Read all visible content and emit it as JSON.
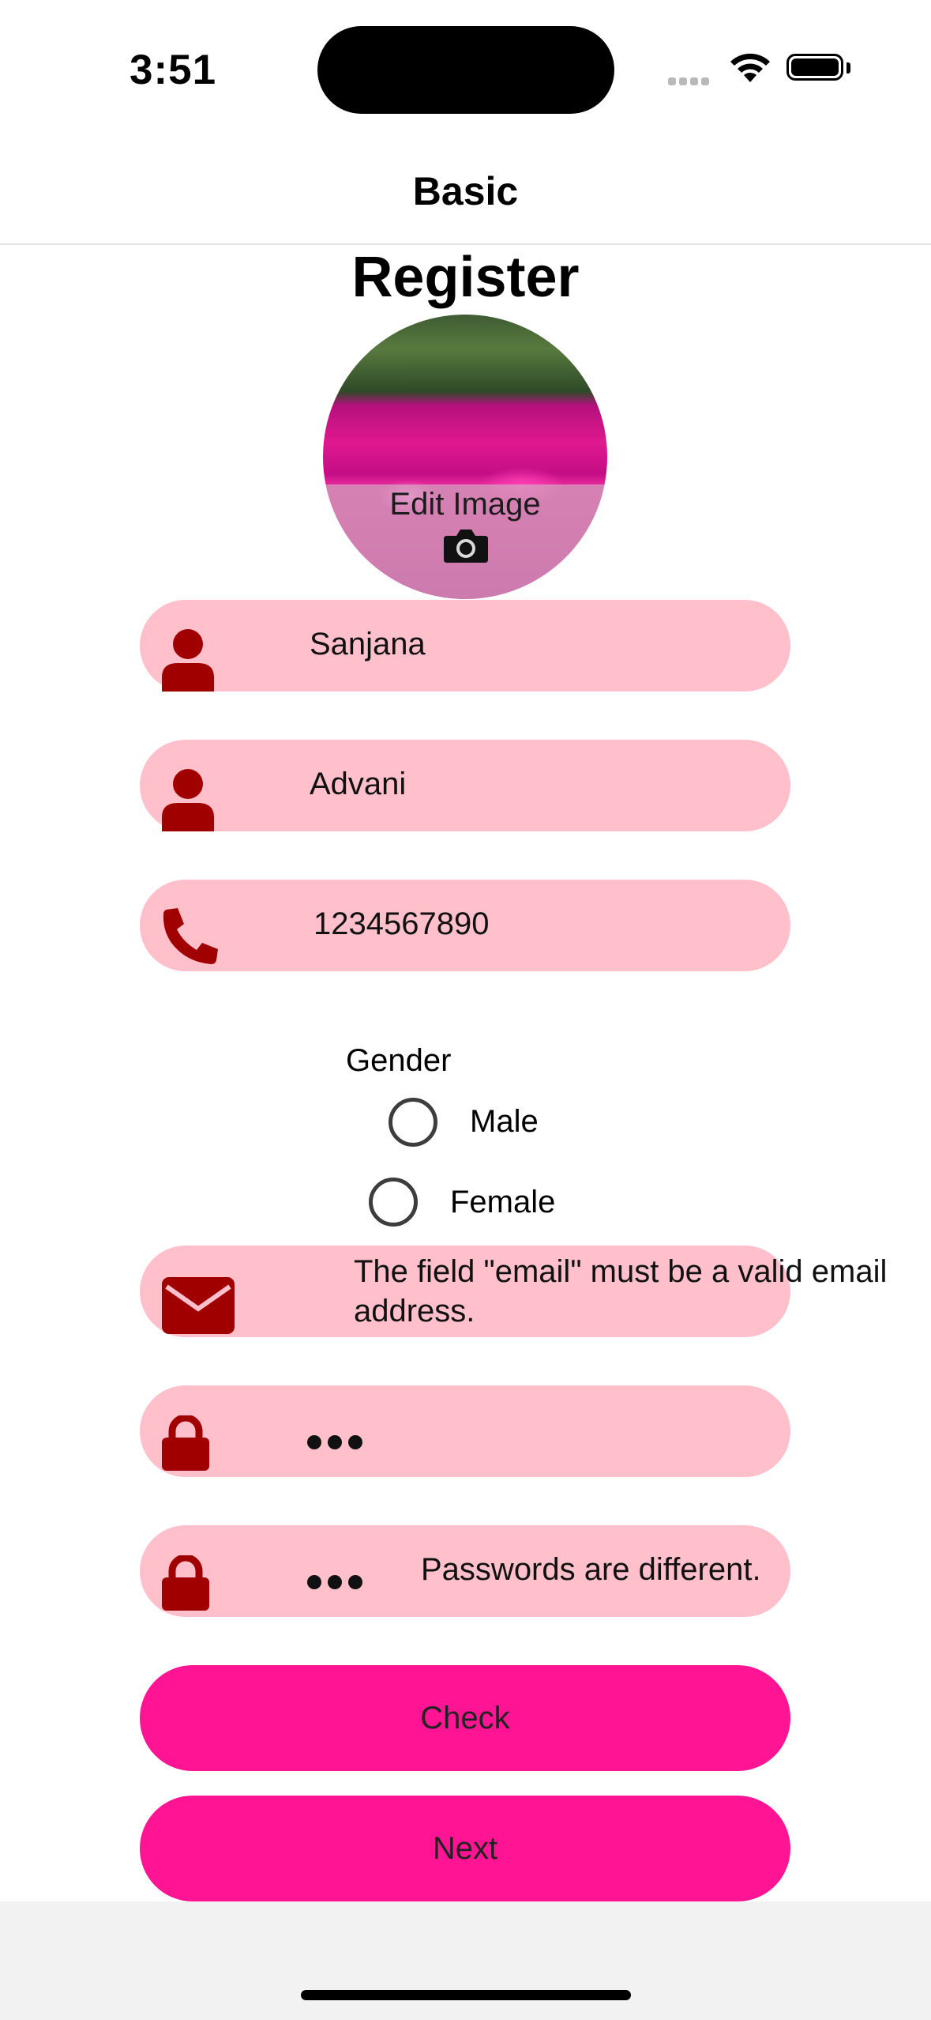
{
  "status_bar": {
    "time": "3:51",
    "icons": [
      "cellular-signal-icon",
      "wifi-icon",
      "battery-icon"
    ]
  },
  "nav": {
    "title": "Basic"
  },
  "page": {
    "title": "Register"
  },
  "avatar": {
    "edit_label": "Edit Image",
    "icon": "camera-icon"
  },
  "form": {
    "first_name": {
      "value": "Sanjana",
      "icon": "person-icon"
    },
    "last_name": {
      "value": "Advani",
      "icon": "person-icon"
    },
    "phone": {
      "value": "1234567890",
      "icon": "phone-icon"
    },
    "gender": {
      "label": "Gender",
      "options": [
        {
          "label": "Male",
          "selected": false
        },
        {
          "label": "Female",
          "selected": false
        }
      ]
    },
    "email": {
      "value": "",
      "error": "The field \"email\" must be a valid email address.",
      "icon": "envelope-icon"
    },
    "password": {
      "masked": "•••",
      "icon": "lock-icon"
    },
    "confirm_password": {
      "masked": "•••",
      "error": "Passwords are different.",
      "icon": "lock-icon"
    }
  },
  "buttons": {
    "check": "Check",
    "next": "Next"
  },
  "colors": {
    "accent": "#ff1493",
    "field_bg": "#ffc0cb",
    "icon": "#a00000"
  }
}
